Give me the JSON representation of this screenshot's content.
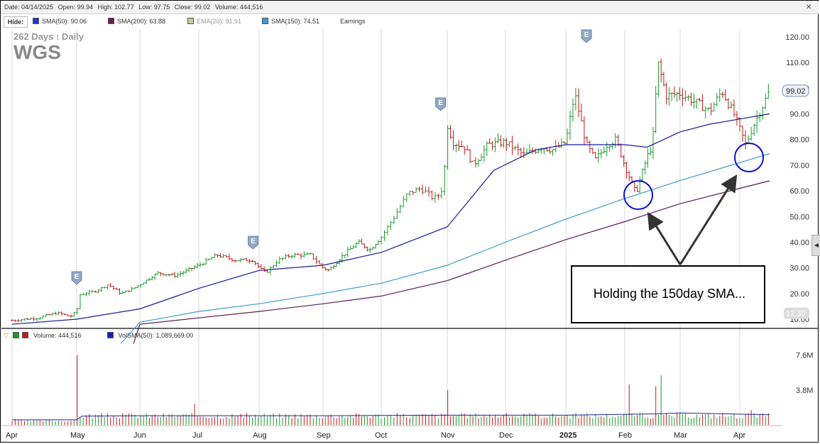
{
  "header": {
    "date": "Date: 04/14/2025",
    "open": "Open: 99.94",
    "high": "High: 102.77",
    "low": "Low: 97.75",
    "close": "Close: 99.02",
    "volume": "Volume: 444,516"
  },
  "legend": {
    "hide_label": "Hide:",
    "sma50": "SMA(50): 90.06",
    "sma200": "SMA(200): 63.88",
    "ema20": "EMA(20): 91.91",
    "sma150": "SMA(150): 74.51",
    "earnings": "Earnings"
  },
  "info": {
    "days": "262  Days : Daily",
    "ticker": "WGS"
  },
  "volume_legend": {
    "volume": "Volume: 444,516",
    "volsma": "VolSMA(50): 1,089,669.00"
  },
  "annotation": {
    "text": "Holding the 150day SMA..."
  },
  "colors": {
    "up": "#1a9a2a",
    "down": "#c41a1a",
    "sma50": "#1b1b9a",
    "sma150": "#3a9bd6",
    "sma200": "#5a1a5a",
    "circle": "#1010d0",
    "arrow": "#333333"
  },
  "chart_data": {
    "type": "line",
    "x": [
      "Apr",
      "May",
      "Jun",
      "Jul",
      "Aug",
      "Sep",
      "Oct",
      "Nov",
      "Dec",
      "2025",
      "Feb",
      "Mar",
      "Apr"
    ],
    "ylim": [
      10,
      120
    ],
    "yticks": [
      "120.00",
      "110.00",
      "100.00",
      "90.00",
      "80.00",
      "70.00",
      "60.00",
      "50.00",
      "40.00",
      "30.00",
      "20.00",
      "10.00"
    ],
    "last_price_label": "99.02",
    "low_price_label": "12.30",
    "earnings_marker": "E",
    "earnings_months": [
      1.0,
      3.9,
      6.9,
      9.35
    ],
    "price_path": [
      [
        0,
        9.5
      ],
      [
        0.4,
        10.5
      ],
      [
        0.7,
        12.5
      ],
      [
        0.9,
        11
      ],
      [
        1.0,
        13
      ],
      [
        1.05,
        19.5
      ],
      [
        1.3,
        21
      ],
      [
        1.5,
        23.5
      ],
      [
        1.7,
        20
      ],
      [
        1.9,
        22
      ],
      [
        2.1,
        25
      ],
      [
        2.3,
        28
      ],
      [
        2.6,
        27
      ],
      [
        2.8,
        29
      ],
      [
        3.0,
        31
      ],
      [
        3.3,
        35
      ],
      [
        3.6,
        33
      ],
      [
        3.9,
        33
      ],
      [
        4.0,
        30
      ],
      [
        4.1,
        28
      ],
      [
        4.3,
        33
      ],
      [
        4.5,
        35
      ],
      [
        4.8,
        35
      ],
      [
        5.0,
        30
      ],
      [
        5.1,
        29
      ],
      [
        5.3,
        34
      ],
      [
        5.6,
        40
      ],
      [
        5.8,
        37
      ],
      [
        6.0,
        42
      ],
      [
        6.2,
        50
      ],
      [
        6.4,
        59
      ],
      [
        6.6,
        61
      ],
      [
        6.8,
        57
      ],
      [
        6.9,
        59
      ],
      [
        6.95,
        65
      ],
      [
        7.0,
        86
      ],
      [
        7.1,
        79
      ],
      [
        7.3,
        77
      ],
      [
        7.45,
        70
      ],
      [
        7.7,
        78
      ],
      [
        8.0,
        79
      ],
      [
        8.3,
        74
      ],
      [
        8.6,
        77
      ],
      [
        8.8,
        76
      ],
      [
        9.0,
        79
      ],
      [
        9.15,
        98
      ],
      [
        9.35,
        78
      ],
      [
        9.5,
        72
      ],
      [
        9.7,
        78
      ],
      [
        9.85,
        80
      ],
      [
        10.0,
        70
      ],
      [
        10.2,
        59
      ],
      [
        10.4,
        73
      ],
      [
        10.5,
        78
      ],
      [
        10.6,
        110
      ],
      [
        10.75,
        97
      ],
      [
        11.0,
        98
      ],
      [
        11.3,
        94
      ],
      [
        11.5,
        91
      ],
      [
        11.7,
        99
      ],
      [
        11.9,
        90
      ],
      [
        12.0,
        84
      ],
      [
        12.1,
        78
      ],
      [
        12.2,
        84
      ],
      [
        12.4,
        94
      ],
      [
        12.5,
        99
      ]
    ],
    "series": [
      {
        "name": "SMA(50): 90.06",
        "values": [
          [
            0,
            8.0
          ],
          [
            1,
            10.0
          ],
          [
            2,
            14
          ],
          [
            3,
            22
          ],
          [
            4,
            29
          ],
          [
            5,
            31
          ],
          [
            6,
            36
          ],
          [
            7,
            46
          ],
          [
            7.8,
            68
          ],
          [
            8.5,
            76
          ],
          [
            9.0,
            78
          ],
          [
            9.5,
            78
          ],
          [
            10.0,
            78
          ],
          [
            10.4,
            77
          ],
          [
            11.0,
            83
          ],
          [
            11.5,
            86
          ],
          [
            12.0,
            88
          ],
          [
            12.5,
            90
          ]
        ]
      },
      {
        "name": "SMA(150): 74.51",
        "values": [
          [
            1.7,
            0.5
          ],
          [
            2,
            8.8
          ],
          [
            3,
            13
          ],
          [
            4,
            16
          ],
          [
            5,
            20
          ],
          [
            6,
            24
          ],
          [
            7,
            31
          ],
          [
            8,
            40
          ],
          [
            9,
            49
          ],
          [
            10,
            57
          ],
          [
            11,
            64
          ],
          [
            12,
            71
          ],
          [
            12.5,
            74.5
          ]
        ]
      },
      {
        "name": "SMA(200): 63.88",
        "values": [
          [
            1.9,
            0.5
          ],
          [
            2,
            8
          ],
          [
            3,
            10.5
          ],
          [
            4,
            13
          ],
          [
            5,
            16
          ],
          [
            6,
            19
          ],
          [
            7,
            25
          ],
          [
            8,
            33
          ],
          [
            9,
            41
          ],
          [
            10,
            48
          ],
          [
            11,
            55
          ],
          [
            12,
            61
          ],
          [
            12.5,
            63.9
          ]
        ]
      }
    ],
    "volume": {
      "ylim": [
        0,
        8.5
      ],
      "yticks": [
        "7.6M",
        "3.8M"
      ],
      "volsma": [
        [
          0,
          0.55
        ],
        [
          1.0,
          0.55
        ],
        [
          1.08,
          0.95
        ],
        [
          2,
          1.0
        ],
        [
          5,
          1.0
        ],
        [
          7,
          1.05
        ],
        [
          9,
          1.05
        ],
        [
          10.6,
          1.2
        ],
        [
          11,
          1.3
        ],
        [
          12.5,
          1.1
        ]
      ],
      "spikes": [
        [
          1.02,
          7.6
        ],
        [
          2.95,
          2.3
        ],
        [
          7.0,
          3.8
        ],
        [
          10.1,
          4.4
        ],
        [
          10.55,
          4.2
        ],
        [
          10.65,
          5.4
        ],
        [
          12.2,
          1.6
        ]
      ]
    }
  }
}
